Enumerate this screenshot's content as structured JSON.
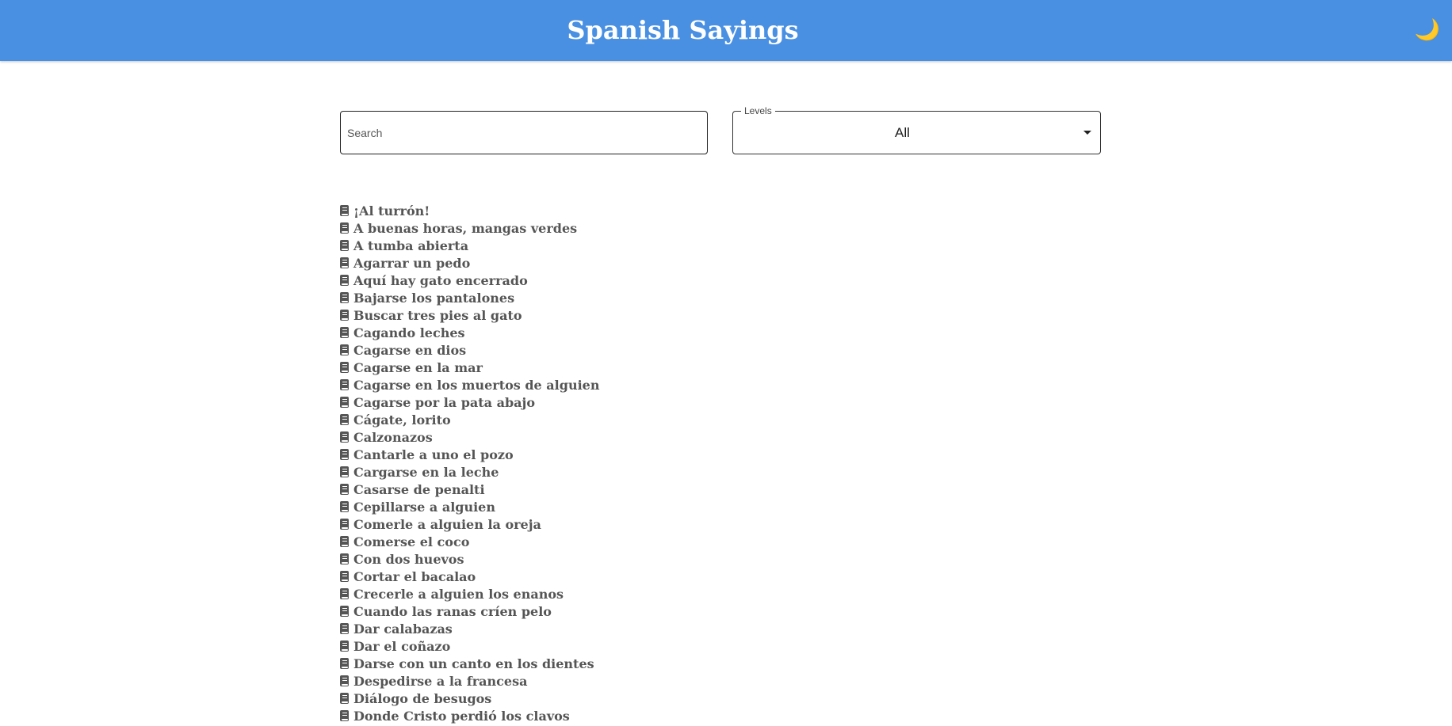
{
  "header": {
    "title": "Spanish Sayings",
    "theme_toggle_icon": "🌙",
    "background_color": "#4a90e2"
  },
  "search": {
    "placeholder": "Search",
    "value": ""
  },
  "levels": {
    "label": "Levels",
    "selected": "All"
  },
  "sayings": [
    "¡Al turrón!",
    "A buenas horas, mangas verdes",
    "A tumba abierta",
    "Agarrar un pedo",
    "Aquí hay gato encerrado",
    "Bajarse los pantalones",
    "Buscar tres pies al gato",
    "Cagando leches",
    "Cagarse en dios",
    "Cagarse en la mar",
    "Cagarse en los muertos de alguien",
    "Cagarse por la pata abajo",
    "Cágate, lorito",
    "Calzonazos",
    "Cantarle a uno el pozo",
    "Cargarse en la leche",
    "Casarse de penalti",
    "Cepillarse a alguien",
    "Comerle a alguien la oreja",
    "Comerse el coco",
    "Con dos huevos",
    "Cortar el bacalao",
    "Crecerle a alguien los enanos",
    "Cuando las ranas críen pelo",
    "Dar calabazas",
    "Dar el coñazo",
    "Darse con un canto en los dientes",
    "Despedirse a la francesa",
    "Diálogo de besugos",
    "Donde Cristo perdió los clavos"
  ]
}
